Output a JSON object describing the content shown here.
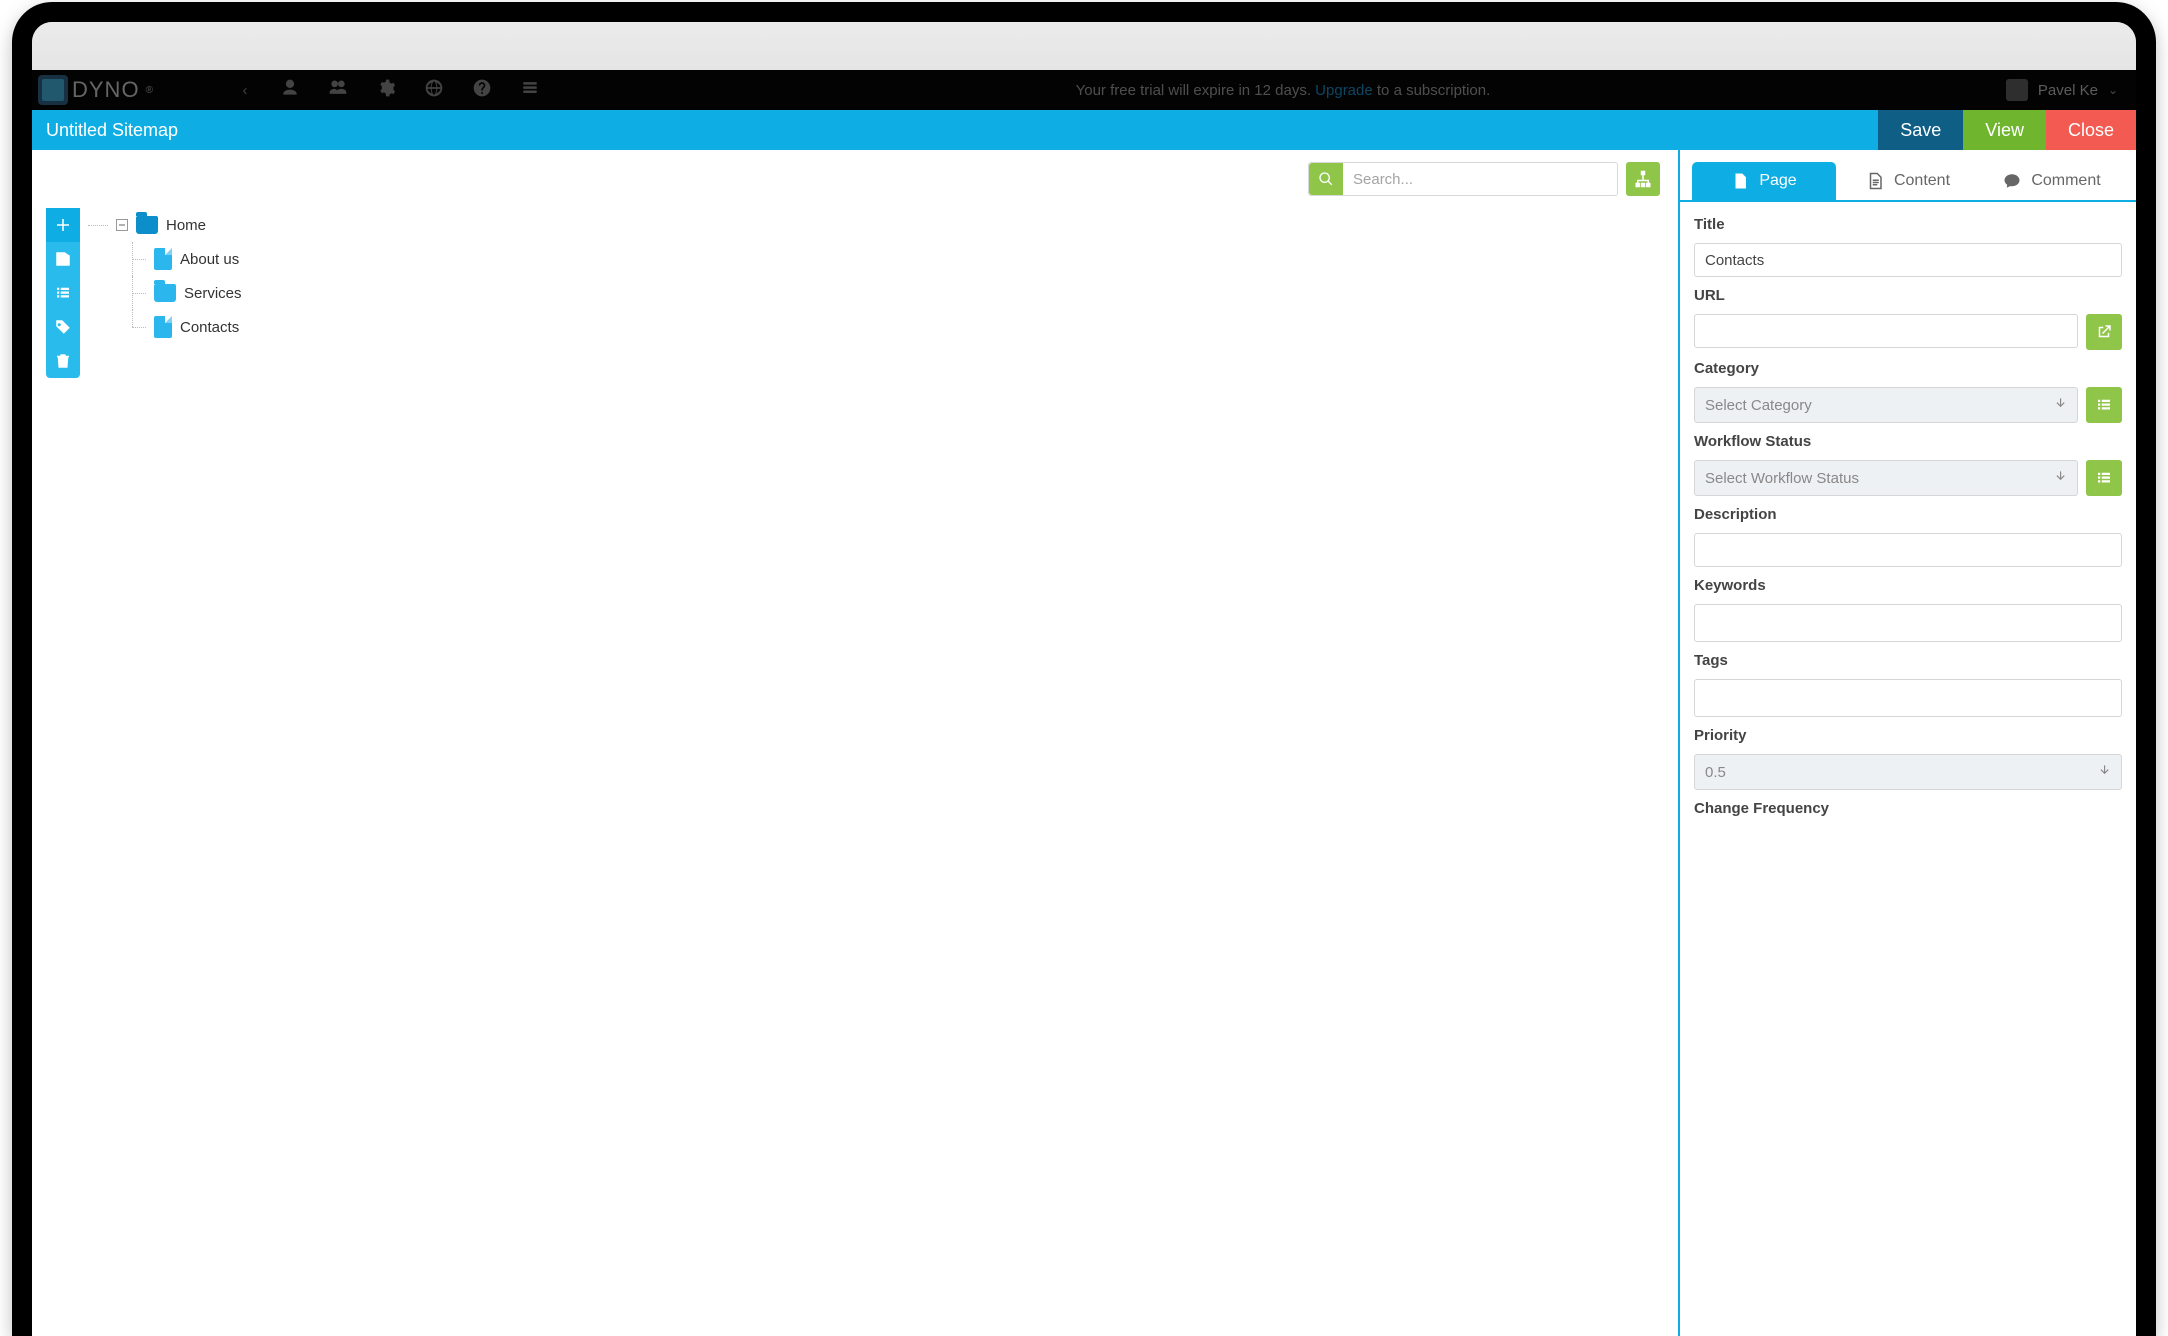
{
  "app_topbar": {
    "brand": "DYNO",
    "trial_prefix": "Your free trial will expire in 12 days. ",
    "upgrade": "Upgrade",
    "trial_suffix": " to a subscription.",
    "user_name": "Pavel Ke"
  },
  "editor_bar": {
    "title": "Untitled Sitemap",
    "save": "Save",
    "view": "View",
    "close": "Close"
  },
  "search": {
    "placeholder": "Search..."
  },
  "tree": {
    "root": "Home",
    "children": [
      {
        "label": "About us",
        "type": "file"
      },
      {
        "label": "Services",
        "type": "folder"
      },
      {
        "label": "Contacts",
        "type": "file"
      }
    ]
  },
  "rtabs": {
    "page": "Page",
    "content": "Content",
    "comment": "Comment"
  },
  "form": {
    "title_label": "Title",
    "title_value": "Contacts",
    "url_label": "URL",
    "url_value": "",
    "category_label": "Category",
    "category_placeholder": "Select Category",
    "workflow_label": "Workflow Status",
    "workflow_placeholder": "Select Workflow Status",
    "description_label": "Description",
    "description_value": "",
    "keywords_label": "Keywords",
    "keywords_value": "",
    "tags_label": "Tags",
    "tags_value": "",
    "priority_label": "Priority",
    "priority_value": "0.5",
    "changefreq_label": "Change Frequency"
  }
}
